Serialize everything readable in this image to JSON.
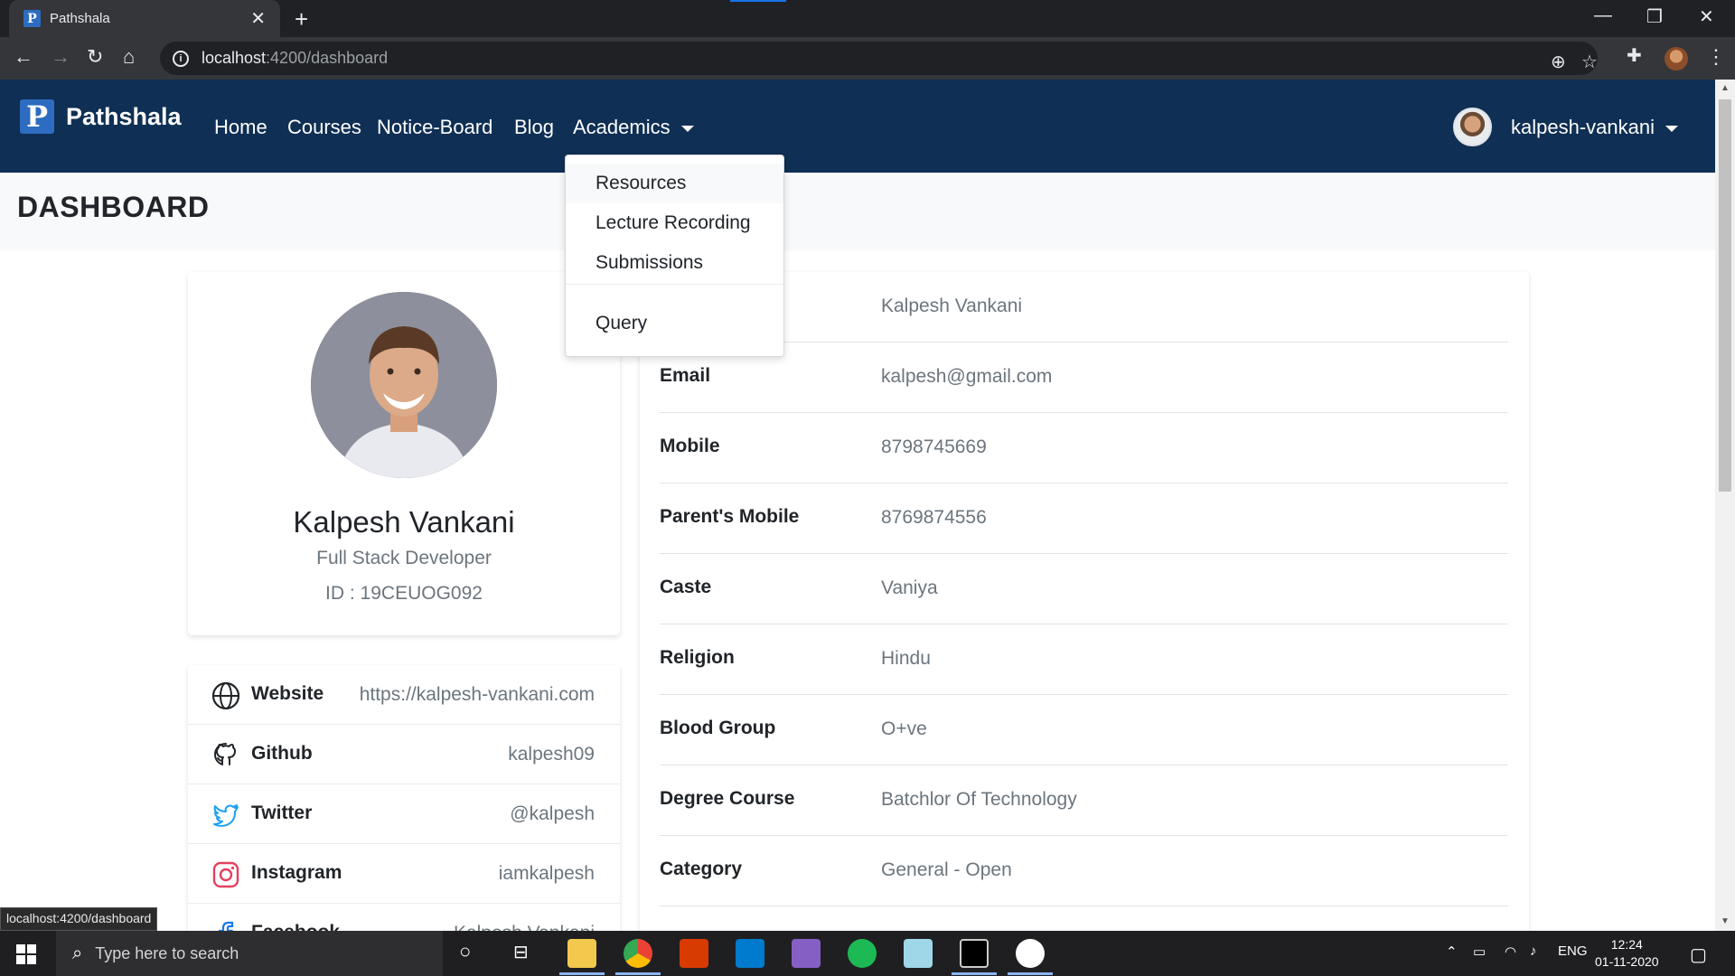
{
  "browser": {
    "tab_title": "Pathshala",
    "favicon_letter": "P",
    "url_host": "localhost",
    "url_path": ":4200/dashboard"
  },
  "navbar": {
    "brand_letter": "P",
    "brand_name": "Pathshala",
    "links": [
      "Home",
      "Courses",
      "Notice-Board",
      "Blog",
      "Academics"
    ],
    "user_name": "kalpesh-vankani"
  },
  "academics_menu": {
    "items": [
      "Resources",
      "Lecture Recording",
      "Submissions"
    ],
    "extra_item": "Query"
  },
  "page": {
    "title": "DASHBOARD"
  },
  "profile": {
    "name": "Kalpesh Vankani",
    "role": "Full Stack Developer",
    "id_text": "ID : 19CEUOG092"
  },
  "social": [
    {
      "label": "Website",
      "value": "https://kalpesh-vankani.com",
      "icon": "globe-icon"
    },
    {
      "label": "Github",
      "value": "kalpesh09",
      "icon": "github-icon"
    },
    {
      "label": "Twitter",
      "value": "@kalpesh",
      "icon": "twitter-icon"
    },
    {
      "label": "Instagram",
      "value": "iamkalpesh",
      "icon": "instagram-icon"
    },
    {
      "label": "Facebook",
      "value": "Kalpesh Vankani",
      "icon": "facebook-icon"
    }
  ],
  "details": [
    {
      "label": "",
      "value": "Kalpesh Vankani"
    },
    {
      "label": "Email",
      "value": "kalpesh@gmail.com"
    },
    {
      "label": "Mobile",
      "value": "8798745669"
    },
    {
      "label": "Parent's Mobile",
      "value": "8769874556"
    },
    {
      "label": "Caste",
      "value": "Vaniya"
    },
    {
      "label": "Religion",
      "value": "Hindu"
    },
    {
      "label": "Blood Group",
      "value": "O+ve"
    },
    {
      "label": "Degree Course",
      "value": "Batchlor Of Technology"
    },
    {
      "label": "Category",
      "value": "General - Open"
    }
  ],
  "status_url": "localhost:4200/dashboard",
  "taskbar": {
    "search_placeholder": "Type here to search",
    "lang": "ENG",
    "time": "12:24",
    "date": "01-11-2020"
  },
  "colors": {
    "navbar": "#0f2f54",
    "brand_logo": "#2d6cc0"
  }
}
